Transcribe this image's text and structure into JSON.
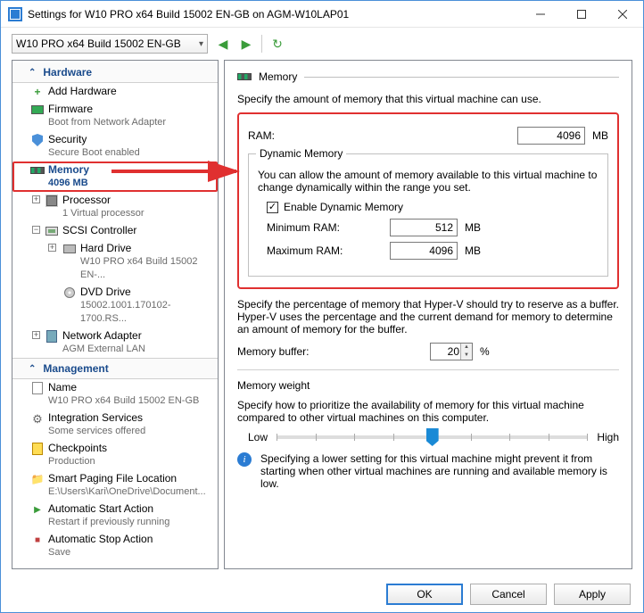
{
  "window": {
    "title": "Settings for W10 PRO x64 Build 15002 EN-GB on AGM-W10LAP01"
  },
  "toolbar": {
    "vm_name": "W10 PRO x64 Build 15002 EN-GB"
  },
  "cats": {
    "hardware": "Hardware",
    "management": "Management"
  },
  "hw": {
    "add": "Add Hardware",
    "firmware": "Firmware",
    "firmware_sub": "Boot from Network Adapter",
    "security": "Security",
    "security_sub": "Secure Boot enabled",
    "memory": "Memory",
    "memory_sub": "4096 MB",
    "processor": "Processor",
    "processor_sub": "1 Virtual processor",
    "scsi": "SCSI Controller",
    "hd": "Hard Drive",
    "hd_sub": "W10 PRO x64 Build 15002 EN-...",
    "dvd": "DVD Drive",
    "dvd_sub": "15002.1001.170102-1700.RS...",
    "net": "Network Adapter",
    "net_sub": "AGM External LAN"
  },
  "mg": {
    "name": "Name",
    "name_sub": "W10 PRO x64 Build 15002 EN-GB",
    "integ": "Integration Services",
    "integ_sub": "Some services offered",
    "chk": "Checkpoints",
    "chk_sub": "Production",
    "spf": "Smart Paging File Location",
    "spf_sub": "E:\\Users\\Kari\\OneDrive\\Document...",
    "auto_start": "Automatic Start Action",
    "auto_start_sub": "Restart if previously running",
    "auto_stop": "Automatic Stop Action",
    "auto_stop_sub": "Save"
  },
  "main": {
    "heading": "Memory",
    "intro": "Specify the amount of memory that this virtual machine can use.",
    "ram_label": "RAM:",
    "ram_value": "4096",
    "ram_unit": "MB",
    "dyn_legend": "Dynamic Memory",
    "dyn_desc": "You can allow the amount of memory available to this virtual machine to change dynamically within the range you set.",
    "dyn_enable": "Enable Dynamic Memory",
    "min_label": "Minimum RAM:",
    "min_value": "512",
    "max_label": "Maximum RAM:",
    "max_value": "4096",
    "buf_desc": "Specify the percentage of memory that Hyper-V should try to reserve as a buffer. Hyper-V uses the percentage and the current demand for memory to determine an amount of memory for the buffer.",
    "buf_label": "Memory buffer:",
    "buf_value": "20",
    "buf_unit": "%",
    "weight_legend": "Memory weight",
    "weight_desc": "Specify how to prioritize the availability of memory for this virtual machine compared to other virtual machines on this computer.",
    "weight_low": "Low",
    "weight_high": "High",
    "weight_info": "Specifying a lower setting for this virtual machine might prevent it from starting when other virtual machines are running and available memory is low."
  },
  "footer": {
    "ok": "OK",
    "cancel": "Cancel",
    "apply": "Apply"
  }
}
